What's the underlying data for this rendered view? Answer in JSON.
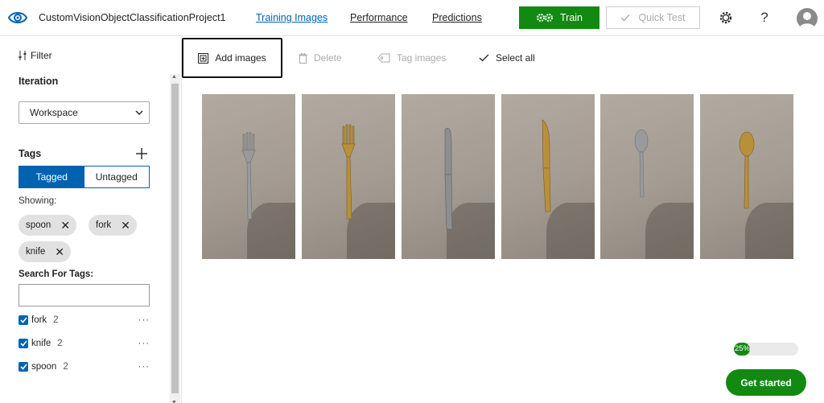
{
  "header": {
    "project_title": "CustomVisionObjectClassificationProject1",
    "tabs": [
      {
        "label": "Training Images",
        "active": true
      },
      {
        "label": "Performance",
        "active": false
      },
      {
        "label": "Predictions",
        "active": false
      }
    ],
    "train_label": "Train",
    "quick_test_label": "Quick Test",
    "help_glyph": "?"
  },
  "sidebar": {
    "filter_label": "Filter",
    "iteration_label": "Iteration",
    "iteration_value": "Workspace",
    "tags_label": "Tags",
    "tagged_label": "Tagged",
    "untagged_label": "Untagged",
    "showing_label": "Showing:",
    "chips": [
      "spoon",
      "fork",
      "knife"
    ],
    "search_label": "Search For Tags:",
    "search_value": "",
    "tags": [
      {
        "name": "fork",
        "count": "2",
        "checked": true
      },
      {
        "name": "knife",
        "count": "2",
        "checked": true
      },
      {
        "name": "spoon",
        "count": "2",
        "checked": true
      }
    ]
  },
  "toolbar": {
    "add_images": "Add images",
    "delete": "Delete",
    "tag_images": "Tag images",
    "select_all": "Select all"
  },
  "images": [
    {
      "subject": "fork",
      "color": "#9a9a9c"
    },
    {
      "subject": "fork",
      "color": "#b8903a"
    },
    {
      "subject": "knife",
      "color": "#8e8e90"
    },
    {
      "subject": "knife",
      "color": "#b8903a"
    },
    {
      "subject": "spoon",
      "color": "#9a9a9c"
    },
    {
      "subject": "spoon",
      "color": "#b8903a"
    }
  ],
  "progress": {
    "label": "25%",
    "value": 0.25
  },
  "get_started_label": "Get started",
  "colors": {
    "accent_blue": "#0063b1",
    "action_green": "#128a12"
  }
}
